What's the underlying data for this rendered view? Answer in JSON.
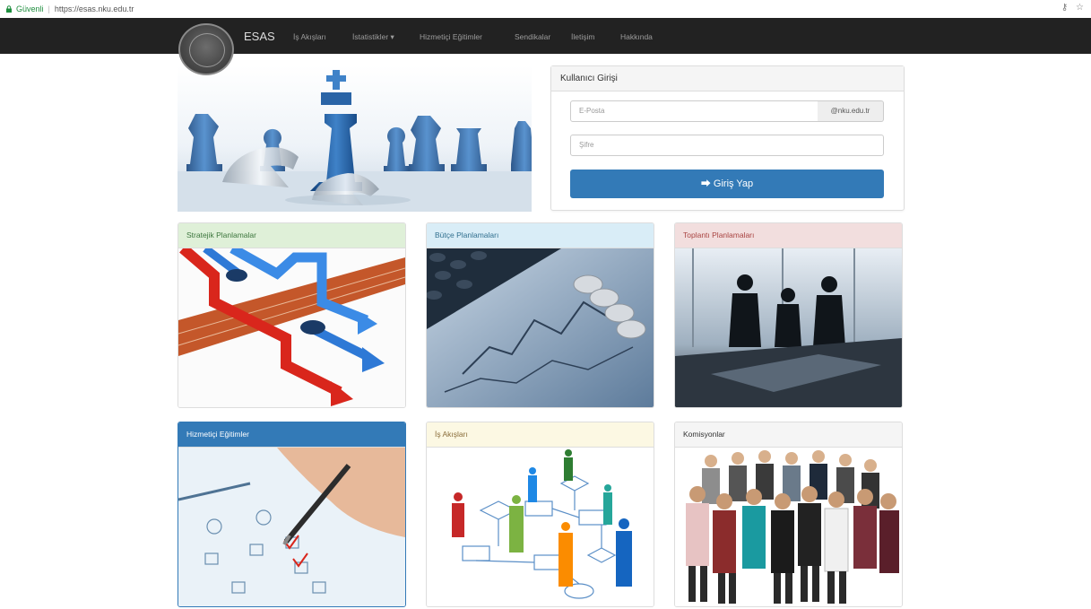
{
  "browser": {
    "secure_label": "Güvenli",
    "url": "https://esas.nku.edu.tr",
    "icons": [
      "key-icon",
      "star-icon"
    ]
  },
  "navbar": {
    "brand": "ESAS",
    "items": [
      {
        "label": "İş Akışları"
      },
      {
        "label": "İstatistikler ▾"
      },
      {
        "label": "Hizmetiçi Eğitimler"
      },
      {
        "label": "Sendikalar"
      },
      {
        "label": "İletişim"
      },
      {
        "label": "Hakkında"
      }
    ]
  },
  "login": {
    "title": "Kullanıcı Girişi",
    "email_placeholder": "E-Posta",
    "email_suffix": "@nku.edu.tr",
    "password_placeholder": "Şifre",
    "submit_label": "Giriş Yap"
  },
  "cards": [
    {
      "title": "Stratejik Planlamalar",
      "header_bg": "#dff0d8",
      "header_color": "#3c763d"
    },
    {
      "title": "Bütçe Planlamaları",
      "header_bg": "#d9edf7",
      "header_color": "#31708f"
    },
    {
      "title": "Toplantı Planlamaları",
      "header_bg": "#f2dede",
      "header_color": "#a94442"
    },
    {
      "title": "Hizmetiçi Eğitimler",
      "header_bg": "#337ab7",
      "header_color": "#ffffff"
    },
    {
      "title": "İş Akışları",
      "header_bg": "#fcf8e3",
      "header_color": "#8a6d3b"
    },
    {
      "title": "Komisyonlar",
      "header_bg": "#f5f5f5",
      "header_color": "#333333"
    }
  ],
  "colors": {
    "navbar": "#222222",
    "primary": "#337ab7"
  }
}
